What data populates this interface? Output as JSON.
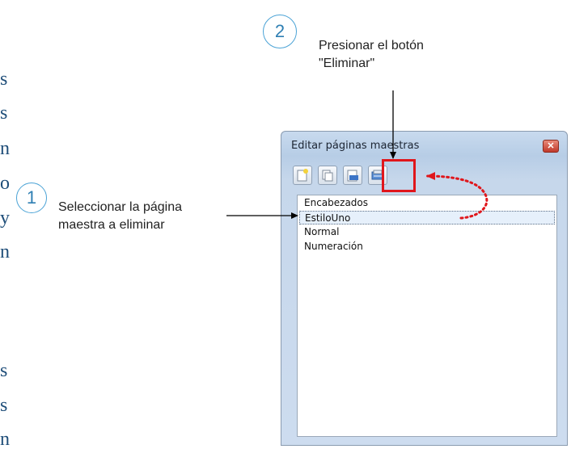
{
  "edge_text": [
    "s",
    "s",
    "n",
    "o",
    "y",
    "n",
    "s",
    "s",
    "n"
  ],
  "steps": [
    {
      "number": "1",
      "text_lines": [
        "Seleccionar la página",
        "maestra a eliminar"
      ]
    },
    {
      "number": "2",
      "text_lines": [
        "Presionar el botón",
        "\"Eliminar\""
      ]
    }
  ],
  "dialog": {
    "title": "Editar páginas maestras",
    "toolbar": [
      {
        "name": "new-page-icon"
      },
      {
        "name": "copy-page-icon"
      },
      {
        "name": "edit-page-icon"
      },
      {
        "name": "delete-page-icon"
      }
    ],
    "items": [
      {
        "label": "Encabezados",
        "selected": false
      },
      {
        "label": "EstiloUno",
        "selected": true
      },
      {
        "label": "Normal",
        "selected": false
      },
      {
        "label": "Numeración",
        "selected": false
      }
    ]
  },
  "colors": {
    "highlight": "#e0161b",
    "step_circle": "#4ba3d6",
    "arrow": "#000000",
    "dotted_arrow": "#e0161b"
  }
}
